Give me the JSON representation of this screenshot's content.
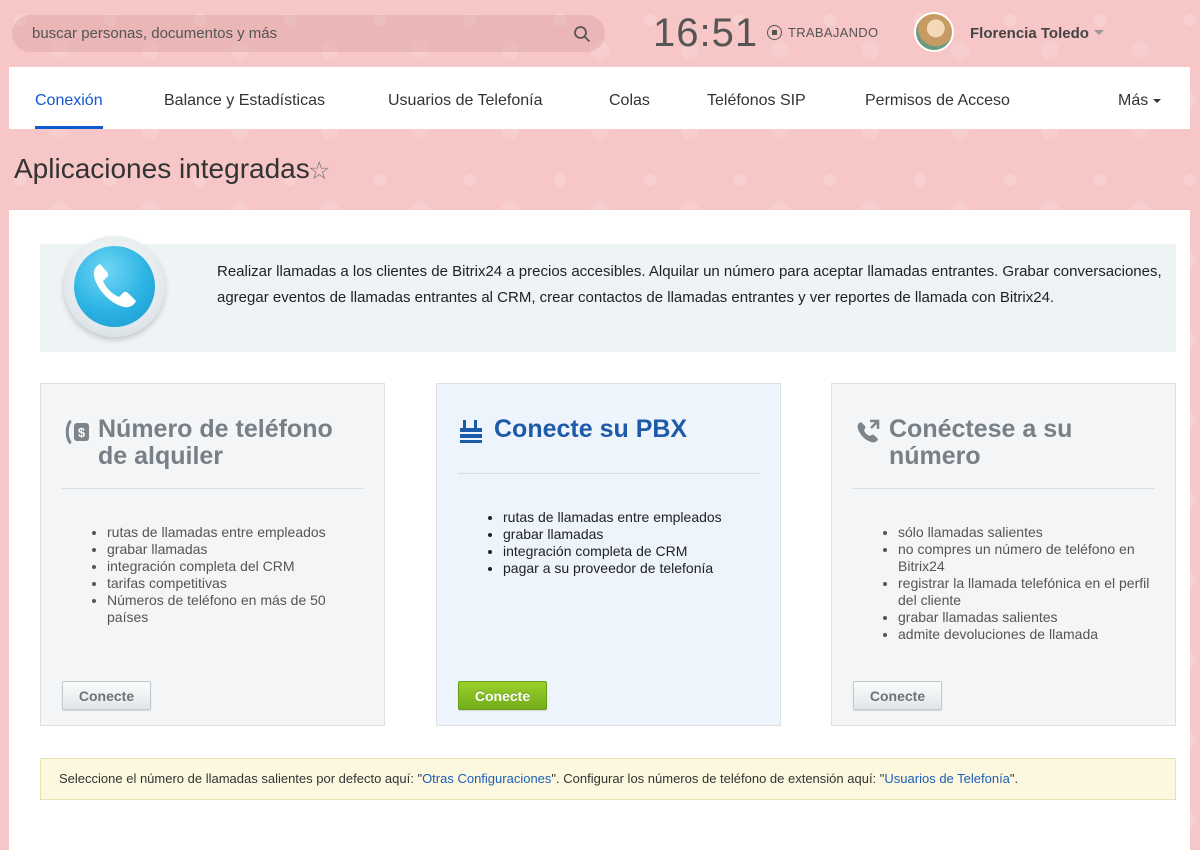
{
  "header": {
    "search_placeholder": "buscar personas, documentos y más",
    "clock": "16:51",
    "status": "TRABAJANDO",
    "user_name": "Florencia Toledo"
  },
  "nav": {
    "tabs": [
      {
        "label": "Conexión",
        "active": true
      },
      {
        "label": "Balance y Estadísticas"
      },
      {
        "label": "Usuarios de Telefonía"
      },
      {
        "label": "Colas"
      },
      {
        "label": "Teléfonos SIP"
      },
      {
        "label": "Permisos de Acceso"
      }
    ],
    "more": "Más"
  },
  "page_title": "Aplicaciones integradas",
  "intro": {
    "text": "Realizar llamadas a los clientes de Bitrix24 a precios accesibles. Alquilar un número para aceptar llamadas entrantes. Grabar conversaciones, agregar eventos de llamadas entrantes al CRM, crear contactos de llamadas entrantes y ver reportes de llamada con Bitrix24."
  },
  "cards": [
    {
      "title": "Número de teléfono de alquiler",
      "items": [
        "rutas de llamadas entre empleados",
        "grabar llamadas",
        "integración completa del CRM",
        "tarifas competitivas",
        "Números de teléfono en más de 50 países"
      ],
      "button": "Conecte"
    },
    {
      "title": "Conecte su PBX",
      "items": [
        "rutas de llamadas entre empleados",
        "grabar llamadas",
        "integración completa de CRM",
        "pagar a su proveedor de telefonía"
      ],
      "button": "Conecte"
    },
    {
      "title": "Conéctese a su número",
      "items": [
        "sólo llamadas salientes",
        "no compres un número de teléfono en Bitrix24",
        "registrar la llamada telefónica en el perfil del cliente",
        "grabar llamadas salientes",
        "admite devoluciones de llamada"
      ],
      "button": "Conecte"
    }
  ],
  "notice": {
    "part1": "Seleccione el número de llamadas salientes por defecto aquí: \"",
    "link1": "Otras Configuraciones",
    "part2": "\". Configurar los números de teléfono de extensión aquí: \"",
    "link2": "Usuarios de Telefonía",
    "part3": "\"."
  }
}
